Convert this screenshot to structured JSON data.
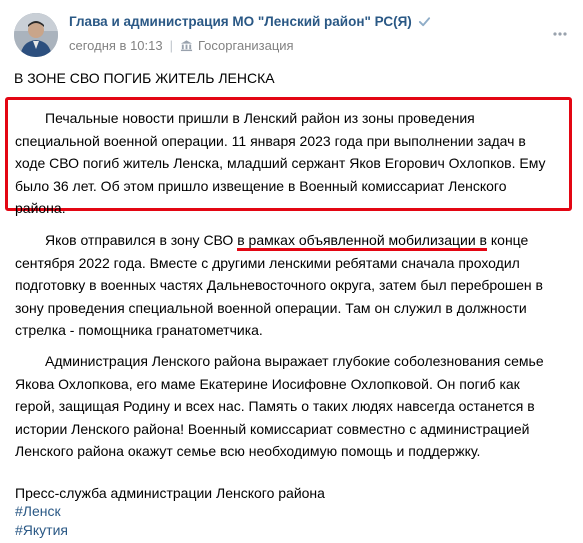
{
  "header": {
    "author": "Глава и администрация МО \"Ленский район\" РС(Я)",
    "time": "сегодня в 10:13",
    "category": "Госорганизация"
  },
  "icons": [
    "verified-icon",
    "government-icon",
    "more-icon",
    "avatar"
  ],
  "colors": {
    "link": "#2a5885",
    "meta": "#828282",
    "highlight": "#e30613"
  },
  "post": {
    "title": "В ЗОНЕ СВО ПОГИБ ЖИТЕЛЬ ЛЕНСКА",
    "paragraph1": [
      "Печальные новости пришли в Ленский район из зоны проведения",
      "специальной военной операции. 11 января 2023 года при выполнении задач в",
      "ходе СВО погиб житель Ленска, младший сержант Яков Егорович Охлопков. Ему",
      "было 36 лет. Об этом пришло извещение в Военный комиссариат Ленского",
      "района."
    ],
    "paragraph2": {
      "line1_before": "Яков отправился в зону СВО ",
      "line1_underlined": "в рамках объявленной мобилизации в",
      "line1_after": " конце",
      "lines": [
        "сентября 2022 года. Вместе с другими ленскими ребятами сначала проходил",
        "подготовку в военных частях Дальневосточного округа, затем был переброшен в",
        "зону проведения специальной военной операции. Там он служил в должности",
        "стрелка - помощника гранатометчика."
      ]
    },
    "paragraph3": [
      "Администрация Ленского района выражает глубокие соболезнования семье",
      "Якова Охлопкова, его маме Екатерине Иосифовне Охлопковой. Он погиб как",
      "герой, защищая Родину и всех нас. Память о таких людях навсегда останется в",
      "истории Ленского района! Военный комиссариат совместно с администрацией",
      "Ленского района окажут семье всю необходимую помощь и поддержку."
    ],
    "signature": "Пресс-служба администрации Ленского района",
    "tags": [
      "#Ленск",
      "#Якутия"
    ]
  }
}
